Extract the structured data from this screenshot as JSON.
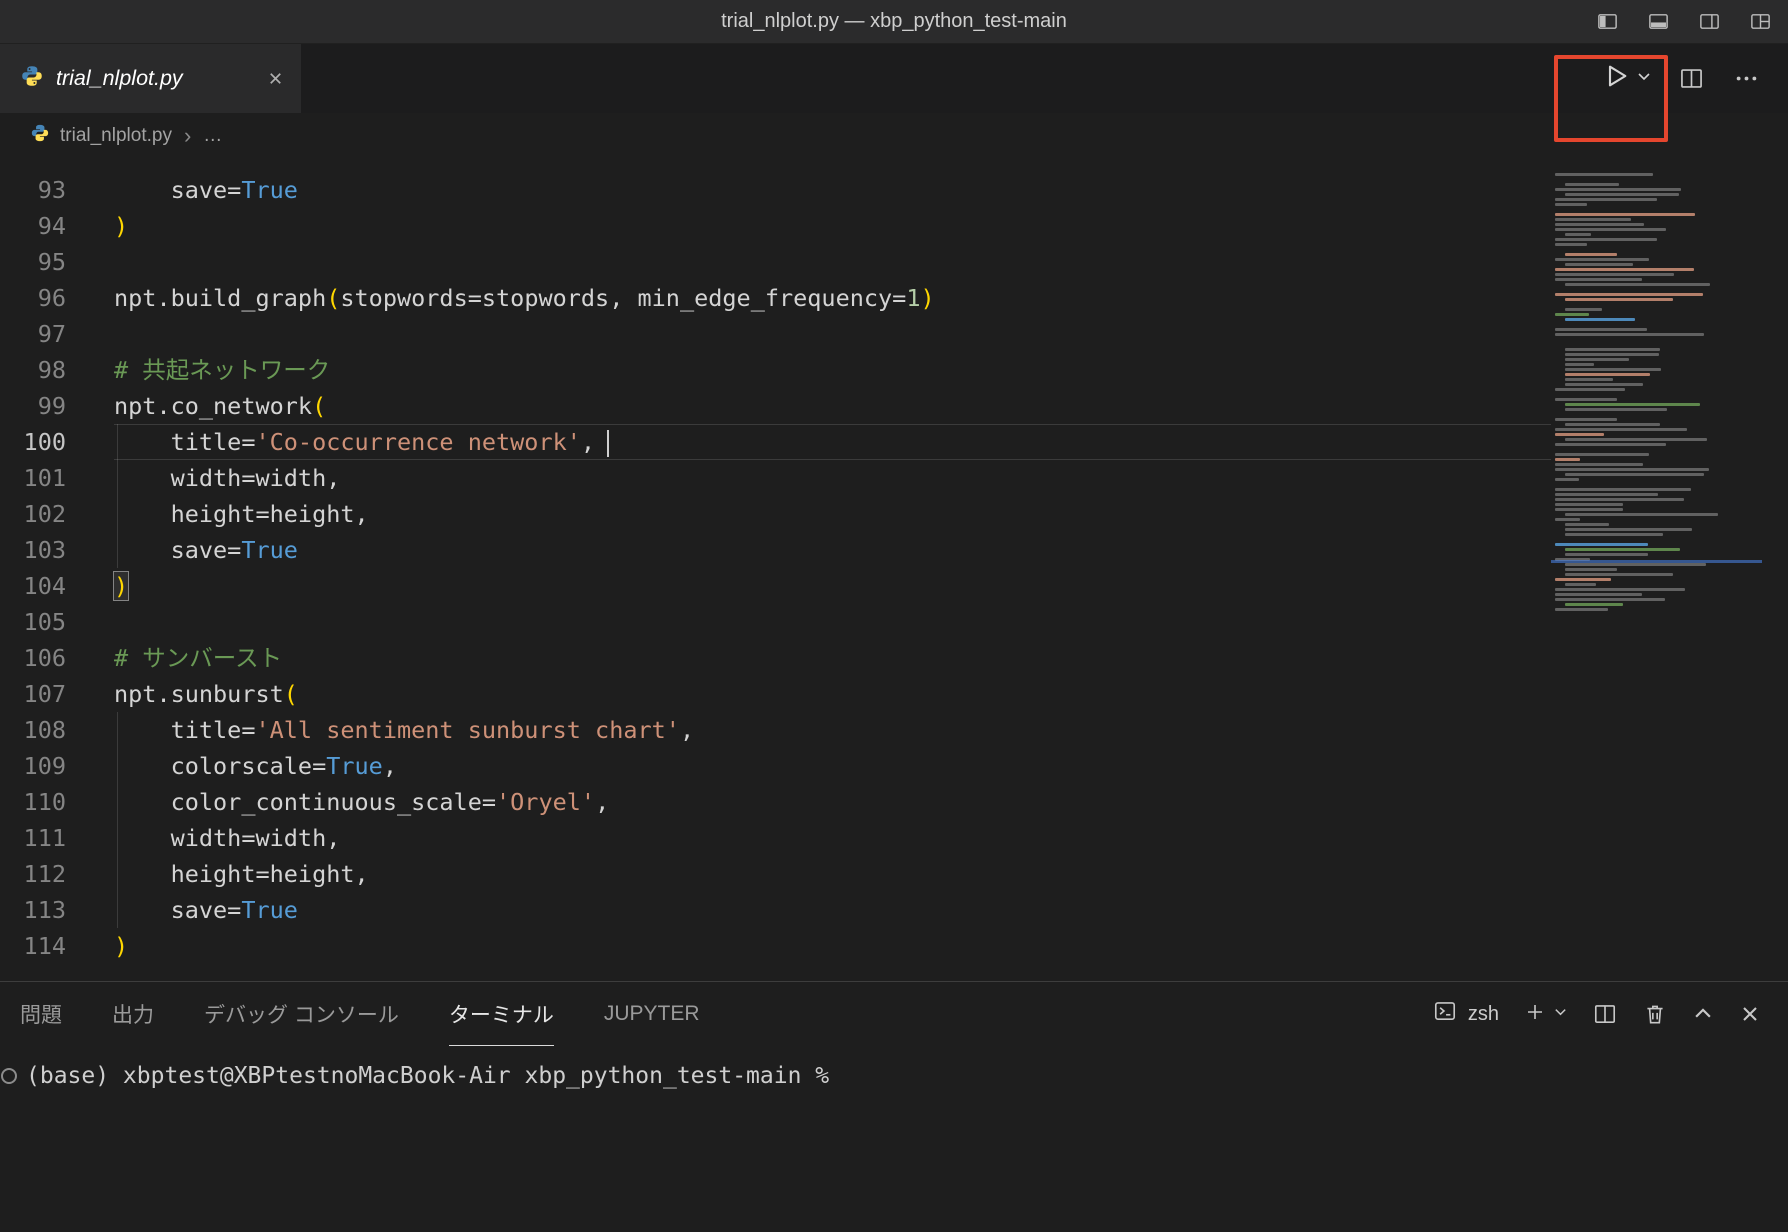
{
  "window": {
    "title": "trial_nlplot.py — xbp_python_test-main"
  },
  "tab": {
    "label": "trial_nlplot.py"
  },
  "breadcrumb": {
    "file": "trial_nlplot.py",
    "more": "…"
  },
  "editor": {
    "cursor_line": 100,
    "lines": [
      {
        "num": 93,
        "tokens": [
          {
            "t": "    save=",
            "c": "p"
          },
          {
            "t": "True",
            "c": "b"
          }
        ]
      },
      {
        "num": 94,
        "tokens": [
          {
            "t": ")",
            "c": "g"
          }
        ]
      },
      {
        "num": 95,
        "tokens": []
      },
      {
        "num": 96,
        "tokens": [
          {
            "t": "npt.build_graph",
            "c": "p"
          },
          {
            "t": "(",
            "c": "g"
          },
          {
            "t": "stopwords=stopwords, min_edge_frequency=",
            "c": "p"
          },
          {
            "t": "1",
            "c": "n"
          },
          {
            "t": ")",
            "c": "g"
          }
        ]
      },
      {
        "num": 97,
        "tokens": []
      },
      {
        "num": 98,
        "tokens": [
          {
            "t": "# 共起ネットワーク",
            "c": "c"
          }
        ]
      },
      {
        "num": 99,
        "tokens": [
          {
            "t": "npt.co_network",
            "c": "p"
          },
          {
            "t": "(",
            "c": "g"
          }
        ]
      },
      {
        "num": 100,
        "current": true,
        "cursor": true,
        "guide": true,
        "tokens": [
          {
            "t": "    title=",
            "c": "p"
          },
          {
            "t": "'Co-occurrence network'",
            "c": "s"
          },
          {
            "t": ",",
            "c": "p"
          }
        ]
      },
      {
        "num": 101,
        "guide": true,
        "tokens": [
          {
            "t": "    width=width,",
            "c": "p"
          }
        ]
      },
      {
        "num": 102,
        "guide": true,
        "tokens": [
          {
            "t": "    height=height,",
            "c": "p"
          }
        ]
      },
      {
        "num": 103,
        "guide": true,
        "tokens": [
          {
            "t": "    save=",
            "c": "p"
          },
          {
            "t": "True",
            "c": "b"
          }
        ]
      },
      {
        "num": 104,
        "tokens": [
          {
            "t": ")",
            "c": "g",
            "m": true
          }
        ]
      },
      {
        "num": 105,
        "tokens": []
      },
      {
        "num": 106,
        "tokens": [
          {
            "t": "# サンバースト",
            "c": "c"
          }
        ]
      },
      {
        "num": 107,
        "tokens": [
          {
            "t": "npt.sunburst",
            "c": "p"
          },
          {
            "t": "(",
            "c": "g"
          }
        ]
      },
      {
        "num": 108,
        "guide": true,
        "tokens": [
          {
            "t": "    title=",
            "c": "p"
          },
          {
            "t": "'All sentiment sunburst chart'",
            "c": "s"
          },
          {
            "t": ",",
            "c": "p"
          }
        ]
      },
      {
        "num": 109,
        "guide": true,
        "tokens": [
          {
            "t": "    colorscale=",
            "c": "p"
          },
          {
            "t": "True",
            "c": "b"
          },
          {
            "t": ",",
            "c": "p"
          }
        ]
      },
      {
        "num": 110,
        "guide": true,
        "tokens": [
          {
            "t": "    color_continuous_scale=",
            "c": "p"
          },
          {
            "t": "'Oryel'",
            "c": "s"
          },
          {
            "t": ",",
            "c": "p"
          }
        ]
      },
      {
        "num": 111,
        "guide": true,
        "tokens": [
          {
            "t": "    width=width,",
            "c": "p"
          }
        ]
      },
      {
        "num": 112,
        "guide": true,
        "tokens": [
          {
            "t": "    height=height,",
            "c": "p"
          }
        ]
      },
      {
        "num": 113,
        "guide": true,
        "tokens": [
          {
            "t": "    save=",
            "c": "p"
          },
          {
            "t": "True",
            "c": "b"
          }
        ]
      },
      {
        "num": 114,
        "tokens": [
          {
            "t": ")",
            "c": "g"
          }
        ]
      }
    ]
  },
  "panel": {
    "tabs": [
      {
        "id": "problems",
        "label": "問題"
      },
      {
        "id": "output",
        "label": "出力"
      },
      {
        "id": "debug-console",
        "label": "デバッグ コンソール"
      },
      {
        "id": "terminal",
        "label": "ターミナル",
        "active": true
      },
      {
        "id": "jupyter",
        "label": "JUPYTER"
      }
    ],
    "shell_label": "zsh"
  },
  "terminal": {
    "prompt": "(base) xbptest@XBPtestnoMacBook-Air xbp_python_test-main %"
  },
  "colors": {
    "annotation": "#e5462e",
    "string": "#ce9178",
    "keyword": "#569cd6",
    "comment": "#6a9955",
    "bracket": "#ffd700",
    "editor_bg": "#1e1e1e"
  }
}
